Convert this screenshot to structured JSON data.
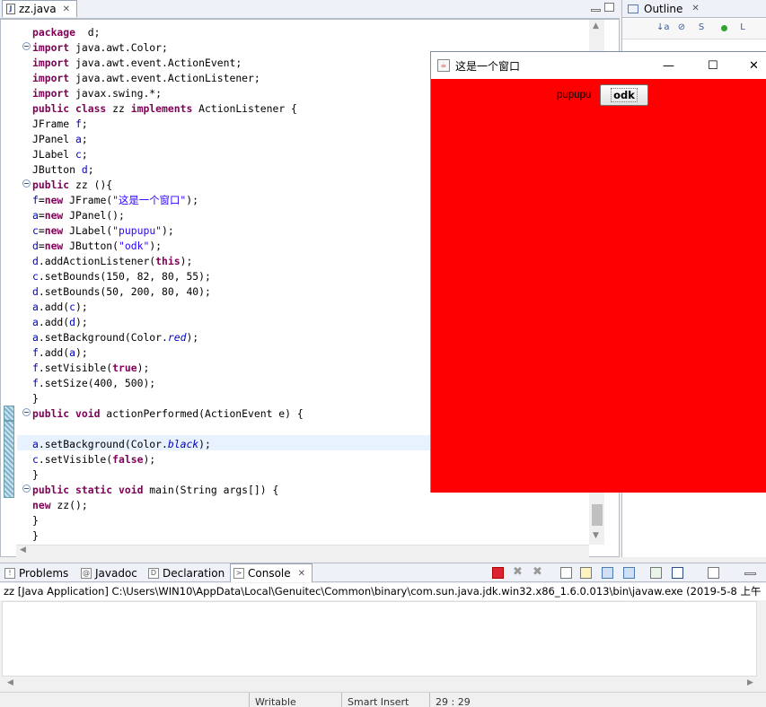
{
  "editor": {
    "tab_label": "zz.java",
    "tab_close": "✕",
    "lines": [
      [
        [
          "kw",
          "package"
        ],
        [
          "",
          "  d;"
        ]
      ],
      [
        [
          "kw",
          "import"
        ],
        [
          "",
          " java.awt.Color;"
        ]
      ],
      [
        [
          "kw",
          "import"
        ],
        [
          "",
          " java.awt.event.ActionEvent;"
        ]
      ],
      [
        [
          "kw",
          "import"
        ],
        [
          "",
          " java.awt.event.ActionListener;"
        ]
      ],
      [
        [
          "kw",
          "import"
        ],
        [
          "",
          " javax.swing.*;"
        ]
      ],
      [
        [
          "kw",
          "public class"
        ],
        [
          "",
          " zz "
        ],
        [
          "kw",
          "implements"
        ],
        [
          "",
          " ActionListener {"
        ]
      ],
      [
        [
          "",
          "JFrame "
        ],
        [
          "fld",
          "f"
        ],
        [
          "",
          ";"
        ]
      ],
      [
        [
          "",
          "JPanel "
        ],
        [
          "fld",
          "a"
        ],
        [
          "",
          ";"
        ]
      ],
      [
        [
          "",
          "JLabel "
        ],
        [
          "fld",
          "c"
        ],
        [
          "",
          ";"
        ]
      ],
      [
        [
          "",
          "JButton "
        ],
        [
          "fld",
          "d"
        ],
        [
          "",
          ";"
        ]
      ],
      [
        [
          "kw",
          "public"
        ],
        [
          "",
          " zz (){"
        ]
      ],
      [
        [
          "fld",
          "f"
        ],
        [
          "",
          "="
        ],
        [
          "kw",
          "new"
        ],
        [
          "",
          " JFrame("
        ],
        [
          "str",
          "\"这是一个窗口\""
        ],
        [
          "",
          ");"
        ]
      ],
      [
        [
          "fld",
          "a"
        ],
        [
          "",
          "="
        ],
        [
          "kw",
          "new"
        ],
        [
          "",
          " JPanel();"
        ]
      ],
      [
        [
          "fld",
          "c"
        ],
        [
          "",
          "="
        ],
        [
          "kw",
          "new"
        ],
        [
          "",
          " JLabel("
        ],
        [
          "str",
          "\"pupupu\""
        ],
        [
          "",
          ");"
        ]
      ],
      [
        [
          "fld",
          "d"
        ],
        [
          "",
          "="
        ],
        [
          "kw",
          "new"
        ],
        [
          "",
          " JButton("
        ],
        [
          "str",
          "\"odk\""
        ],
        [
          "",
          ");"
        ]
      ],
      [
        [
          "fld",
          "d"
        ],
        [
          "",
          ".addActionListener("
        ],
        [
          "kw",
          "this"
        ],
        [
          "",
          ");"
        ]
      ],
      [
        [
          "fld",
          "c"
        ],
        [
          "",
          ".setBounds(150, 82, 80, 55);"
        ]
      ],
      [
        [
          "fld",
          "d"
        ],
        [
          "",
          ".setBounds(50, 200, 80, 40);"
        ]
      ],
      [
        [
          "fld",
          "a"
        ],
        [
          "",
          ".add("
        ],
        [
          "fld",
          "c"
        ],
        [
          "",
          ");"
        ]
      ],
      [
        [
          "fld",
          "a"
        ],
        [
          "",
          ".add("
        ],
        [
          "fld",
          "d"
        ],
        [
          "",
          ");"
        ]
      ],
      [
        [
          "fld",
          "a"
        ],
        [
          "",
          ".setBackground(Color."
        ],
        [
          "it",
          "red"
        ],
        [
          "",
          ");"
        ]
      ],
      [
        [
          "fld",
          "f"
        ],
        [
          "",
          ".add("
        ],
        [
          "fld",
          "a"
        ],
        [
          "",
          ");"
        ]
      ],
      [
        [
          "fld",
          "f"
        ],
        [
          "",
          ".setVisible("
        ],
        [
          "kw",
          "true"
        ],
        [
          "",
          ");"
        ]
      ],
      [
        [
          "fld",
          "f"
        ],
        [
          "",
          ".setSize(400, 500);"
        ]
      ],
      [
        [
          "",
          "}"
        ]
      ],
      [
        [
          "kw",
          "public void"
        ],
        [
          "",
          " actionPerformed(ActionEvent e) {"
        ]
      ],
      [
        [
          "",
          ""
        ]
      ],
      [
        [
          "fld",
          "a"
        ],
        [
          "",
          ".setBackground(Color."
        ],
        [
          "it",
          "black"
        ],
        [
          "",
          ");"
        ]
      ],
      [
        [
          "fld",
          "c"
        ],
        [
          "",
          ".setVisible("
        ],
        [
          "kw",
          "false"
        ],
        [
          "",
          ");"
        ]
      ],
      [
        [
          "",
          "}"
        ]
      ],
      [
        [
          "kw",
          "public static void"
        ],
        [
          "",
          " main(String args[]) {"
        ]
      ],
      [
        [
          "kw",
          "new"
        ],
        [
          "",
          " zz();"
        ]
      ],
      [
        [
          "",
          "}"
        ]
      ],
      [
        [
          "",
          "}"
        ]
      ]
    ]
  },
  "outline": {
    "tab_label": "Outline",
    "tab_close": "✕",
    "toolbar_icons": [
      "sort-alpha-icon",
      "hide-fields-icon",
      "hide-static-icon",
      "hide-nonpublic-icon",
      "hide-local-types-icon"
    ]
  },
  "jframe": {
    "title": "这是一个窗口",
    "minimize": "—",
    "maximize": "☐",
    "close": "✕",
    "label_text": "pupupu",
    "button_text": "odk",
    "panel_color": "#ff0000"
  },
  "console": {
    "tabs": [
      {
        "name": "problems",
        "label": "Problems",
        "icon": "!"
      },
      {
        "name": "javadoc",
        "label": "Javadoc",
        "icon": "@"
      },
      {
        "name": "declaration",
        "label": "Declaration",
        "icon": "D"
      },
      {
        "name": "console",
        "label": "Console",
        "icon": ">"
      }
    ],
    "active_close": "✕",
    "header": "zz [Java Application] C:\\Users\\WIN10\\AppData\\Local\\Genuitec\\Common\\binary\\com.sun.java.jdk.win32.x86_1.6.0.013\\bin\\javaw.exe (2019-5-8 上午"
  },
  "statusbar": {
    "writable": "Writable",
    "insert_mode": "Smart Insert",
    "position": "29 : 29"
  }
}
